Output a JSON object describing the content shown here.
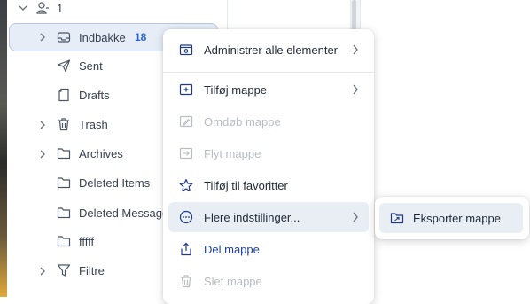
{
  "folders": [
    {
      "label": "1",
      "icon": "user-icon",
      "expand": "chevron-down-icon"
    },
    {
      "label": "Indbakke",
      "badge": "18",
      "icon": "inbox-icon",
      "expand": "chevron-right-icon"
    },
    {
      "label": "Sent",
      "icon": "send-icon"
    },
    {
      "label": "Drafts",
      "icon": "draft-icon"
    },
    {
      "label": "Trash",
      "icon": "trash-icon",
      "expand": "chevron-right-icon"
    },
    {
      "label": "Archives",
      "icon": "folder-icon",
      "expand": "chevron-right-icon"
    },
    {
      "label": "Deleted Items",
      "icon": "folder-icon"
    },
    {
      "label": "Deleted Messages",
      "icon": "folder-icon"
    },
    {
      "label": "fffff",
      "icon": "folder-icon"
    },
    {
      "label": "Filtre",
      "icon": "filter-icon",
      "expand": "chevron-right-icon"
    }
  ],
  "context_menu": {
    "items": [
      {
        "label": "Administrer alle elementer",
        "icon": "manage-folder-icon",
        "submenu": true,
        "enabled": true
      },
      {
        "label": "Tilføj mappe",
        "icon": "add-folder-icon",
        "submenu": true,
        "enabled": true
      },
      {
        "label": "Omdøb mappe",
        "icon": "rename-folder-icon",
        "enabled": false
      },
      {
        "label": "Flyt mappe",
        "icon": "move-folder-icon",
        "enabled": false
      },
      {
        "label": "Tilføj til favoritter",
        "icon": "star-icon",
        "enabled": true
      },
      {
        "label": "Flere indstillinger...",
        "icon": "more-options-icon",
        "submenu": true,
        "enabled": true,
        "highlighted": true
      },
      {
        "label": "Del mappe",
        "icon": "share-icon",
        "enabled": true
      },
      {
        "label": "Slet mappe",
        "icon": "delete-icon",
        "enabled": false
      }
    ]
  },
  "submenu": {
    "items": [
      {
        "label": "Eksporter mappe",
        "icon": "export-folder-icon"
      }
    ]
  },
  "colors": {
    "accent": "#1e40af",
    "badge": "#2563eb",
    "selection": "#e6edf7",
    "highlight": "#e9eef5",
    "disabled": "#b8bcc4"
  }
}
